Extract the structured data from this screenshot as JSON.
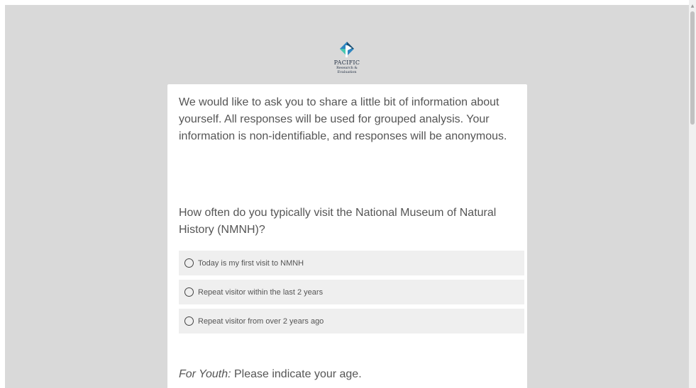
{
  "logo": {
    "name": "PACIFIC",
    "subtitle_line1": "Research &",
    "subtitle_line2": "Evaluation",
    "icon": "pacific-logo-icon"
  },
  "intro": {
    "text": "We would like to ask you to share a little bit of information about yourself. All responses will be used for grouped analysis. Your information is non-identifiable, and responses will be anonymous."
  },
  "question": {
    "text": "How often do you typically visit the National Museum of Natural History (NMNH)?",
    "options": [
      {
        "label": "Today is my first visit to NMNH"
      },
      {
        "label": "Repeat visitor within the last 2 years"
      },
      {
        "label": "Repeat visitor from over 2 years ago"
      }
    ]
  },
  "youth": {
    "prefix": "For Youth:",
    "text": " Please indicate your age."
  },
  "colors": {
    "page_background": "#d9d9d9",
    "card_background": "#ffffff",
    "option_background": "#efefef",
    "text": "#555555"
  }
}
